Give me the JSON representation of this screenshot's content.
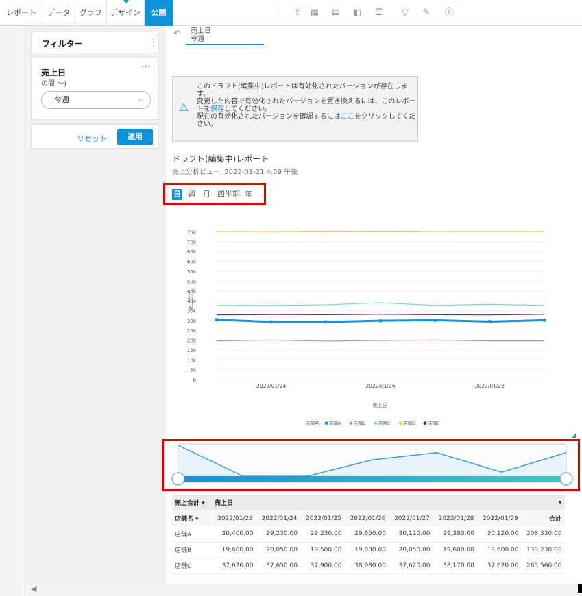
{
  "tabs": [
    {
      "label": "レポート"
    },
    {
      "label": "データ"
    },
    {
      "label": "グラフ"
    },
    {
      "label": "デザイン"
    },
    {
      "label": "公開"
    }
  ],
  "toolbar_icons": [
    "export-icon",
    "calendar-icon",
    "table-icon",
    "panel-icon",
    "list-icon",
    "filter-icon",
    "pen-icon",
    "info-icon"
  ],
  "filter": {
    "title": "フィルター",
    "field_name": "売上日",
    "field_sub": "の間 ～)",
    "select_value": "今週",
    "reset_label": "リセット",
    "apply_label": "適用"
  },
  "chip": {
    "line1": "売上日",
    "line2": "今週"
  },
  "notice": {
    "p1": "このドラフト(編集中)レポートは有効化されたバージョンが存在します。",
    "p2a": "変更した内容で有効化されたバージョンを置き換えるには、このレポートを",
    "p2link": "保存",
    "p2b": "してください。",
    "p3a": "現在の有効化されたバージョンを確認するには",
    "p3link": "ここ",
    "p3b": "をクリックしてください。"
  },
  "report": {
    "title": "ドラフト(編集中)レポート",
    "subtitle": "売上分析ビュー, 2022-01-21 4:59 午後"
  },
  "granularity": [
    {
      "label": "日"
    },
    {
      "label": "週"
    },
    {
      "label": "月"
    },
    {
      "label": "四半期"
    },
    {
      "label": "年"
    }
  ],
  "colors": {
    "accent": "#0e93d8",
    "highlight": "#e00000"
  },
  "chart_data": {
    "type": "line",
    "x": [
      "2022/01/23",
      "2022/01/24",
      "2022/01/25",
      "2022/01/26",
      "2022/01/27",
      "2022/01/28",
      "2022/01/29"
    ],
    "xticks": [
      "2022/01/24",
      "2022/01/26",
      "2022/01/28"
    ],
    "yticks": [
      "0",
      "5k",
      "10k",
      "15k",
      "20k",
      "25k",
      "30k",
      "35k",
      "40k",
      "45k",
      "50k",
      "55k",
      "60k",
      "65k",
      "70k",
      "75k"
    ],
    "ylim": [
      0,
      75000
    ],
    "xlabel": "売上日",
    "ylabel": "売上合計",
    "legend_title": "店舗名:",
    "series": [
      {
        "name": "店舗A",
        "color": "#0e93d8",
        "values": [
          30400,
          29230,
          29230,
          29850,
          30120,
          29380,
          30120
        ]
      },
      {
        "name": "店舗B",
        "color": "#b48fd6",
        "values": [
          19600,
          20050,
          19500,
          19830,
          20050,
          19600,
          19600
        ]
      },
      {
        "name": "店舗C",
        "color": "#7fd3de",
        "values": [
          37620,
          37650,
          37900,
          38980,
          37620,
          38170,
          37620
        ]
      },
      {
        "name": "店舗D",
        "color": "#f5c842",
        "values": [
          75200,
          75100,
          75300,
          75250,
          75200,
          75150,
          75200
        ]
      },
      {
        "name": "店舗E",
        "color": "#8c1d5c",
        "values": [
          32800,
          33000,
          32900,
          33100,
          32900,
          32800,
          33100
        ]
      }
    ],
    "grid": true,
    "legend_position": "bottom"
  },
  "table": {
    "measure_label": "売上合計",
    "dim_label": "売上日",
    "row_header": "店舗名",
    "columns": [
      "2022/01/23",
      "2022/01/24",
      "2022/01/25",
      "2022/01/26",
      "2022/01/27",
      "2022/01/28",
      "2022/01/29",
      "合計"
    ],
    "rows": [
      {
        "name": "店舗A",
        "values": [
          "30,400.00",
          "29,230.00",
          "29,230.00",
          "29,850.00",
          "30,120.00",
          "29,380.00",
          "30,120.00",
          "208,330.00"
        ]
      },
      {
        "name": "店舗B",
        "values": [
          "19,600.00",
          "20,050.00",
          "19,500.00",
          "19,830.00",
          "20,050.00",
          "19,600.00",
          "19,600.00",
          "138,230.00"
        ]
      },
      {
        "name": "店舗C",
        "values": [
          "37,620.00",
          "37,650.00",
          "37,900.00",
          "38,980.00",
          "37,620.00",
          "38,170.00",
          "37,620.00",
          "265,560.00"
        ]
      }
    ]
  }
}
